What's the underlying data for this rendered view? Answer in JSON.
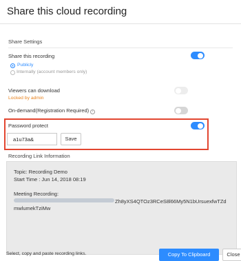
{
  "dialog": {
    "title": "Share this cloud recording"
  },
  "share_settings": {
    "heading": "Share Settings",
    "share_recording": {
      "label": "Share this recording",
      "enabled": true,
      "options": [
        {
          "label": "Publicly",
          "selected": true
        },
        {
          "label": "Internally (account members only)",
          "selected": false
        }
      ]
    },
    "viewers_download": {
      "label": "Viewers can download",
      "enabled": false,
      "lock_note": "Locked by admin"
    },
    "on_demand": {
      "label": "On-demand(Registration Required)",
      "enabled": false,
      "info_icon": "info-icon"
    },
    "password_protect": {
      "label": "Password protect",
      "enabled": true,
      "password_value": "a1u73a&",
      "save_label": "Save"
    }
  },
  "recording_link": {
    "heading": "Recording Link Information",
    "topic": "Topic: Recording Demo",
    "start_time": "Start Time : Jun 14, 2018 08:19",
    "meeting_recording_label": "Meeting Recording:",
    "url_tail": "Zh8yXS4QTOz3RCeS8l66My5N1bUrsuexfwTZd",
    "url_line2": "mwlumekTziMw"
  },
  "footer": {
    "hint": "Select, copy and paste recording links.",
    "copy_label": "Copy To Clipboard",
    "close_label": "Close"
  },
  "colors": {
    "accent": "#2d8cff",
    "highlight_border": "#e2452f",
    "locked_text": "#e8801a"
  }
}
